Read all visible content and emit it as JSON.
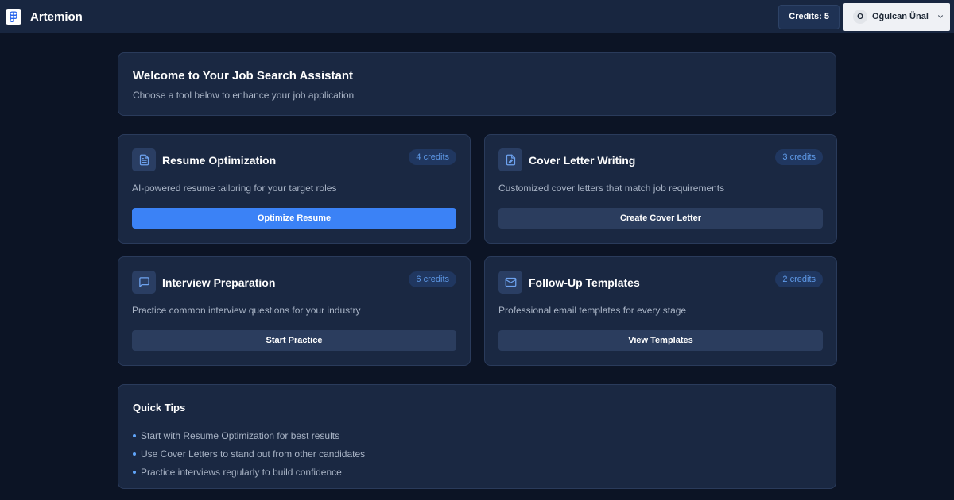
{
  "app": {
    "name": "Artemion",
    "logo_icon": "figma-logo-icon"
  },
  "header": {
    "credits_label": "Credits: 5",
    "user": {
      "initial": "O",
      "name": "Oğulcan Ünal",
      "menu_icon": "chevron-down-icon"
    }
  },
  "welcome": {
    "title": "Welcome to Your Job Search Assistant",
    "subtitle": "Choose a tool below to enhance your job application"
  },
  "tools": [
    {
      "title": "Resume Optimization",
      "badge": "4 credits",
      "description": "AI-powered resume tailoring for your target roles",
      "button": "Optimize Resume",
      "icon": "document-icon"
    },
    {
      "title": "Cover Letter Writing",
      "badge": "3 credits",
      "description": "Customized cover letters that match job requirements",
      "button": "Create Cover Letter",
      "icon": "file-edit-icon"
    },
    {
      "title": "Interview Preparation",
      "badge": "6 credits",
      "description": "Practice common interview questions for your industry",
      "button": "Start Practice",
      "icon": "message-square-icon"
    },
    {
      "title": "Follow-Up Templates",
      "badge": "2 credits",
      "description": "Professional email templates for every stage",
      "button": "View Templates",
      "icon": "mail-icon"
    }
  ],
  "tips": {
    "title": "Quick Tips",
    "items": [
      "Start with Resume Optimization for best results",
      "Use Cover Letters to stand out from other candidates",
      "Practice interviews regularly to build confidence"
    ]
  },
  "colors": {
    "page_bg": "#0c1425",
    "header_bg": "#182640",
    "card_bg": "#1a2842",
    "accent": "#3b82f6",
    "badge_text": "#5f9ae8",
    "muted_text": "#a9b4c6"
  }
}
